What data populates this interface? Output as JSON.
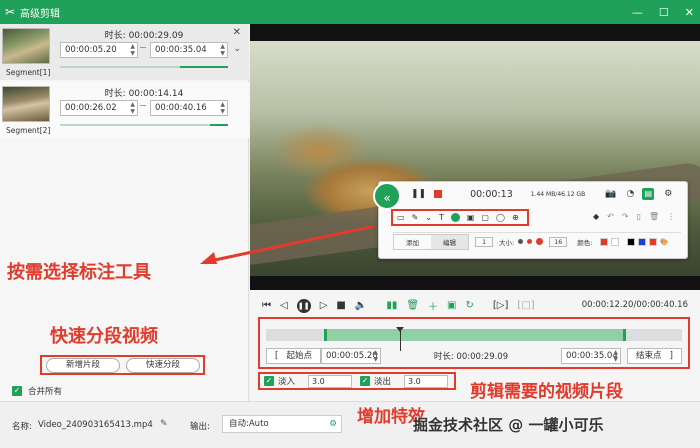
{
  "app": {
    "title": "高级剪辑",
    "window_controls": [
      "—",
      "☐",
      "✕"
    ]
  },
  "segments": [
    {
      "label": "Segment[1]",
      "duration": "时长: 00:00:29.09",
      "start": "00:00:05.20",
      "end": "00:00:35.04"
    },
    {
      "label": "Segment[2]",
      "duration": "时长: 00:00:14.14",
      "start": "00:00:26.02",
      "end": "00:00:40.16"
    }
  ],
  "segment_buttons": {
    "add": "新增片段",
    "quick_split": "快速分段"
  },
  "merge_all": "合并所有",
  "floating_toolbar": {
    "time": "00:00:13",
    "size": "1.44 MB/46.12 GB",
    "tab_add": "添加",
    "tab_edit": "编辑",
    "size_value": "1",
    "size_label": "大小:",
    "stroke_value": "16",
    "color_label": "颜色:"
  },
  "playback": {
    "time_display": "00:00:12.20/00:00:40.16"
  },
  "range": {
    "start_button": "起始点",
    "start_value": "00:00:05.20",
    "duration": "时长: 00:00:29.09",
    "end_value": "00:00:35.04",
    "end_button": "结束点",
    "left_bracket": "[",
    "right_bracket": "]"
  },
  "fade": {
    "fade_in_label": "淡入",
    "fade_in_value": "3.0",
    "fade_out_label": "淡出",
    "fade_out_value": "3.0"
  },
  "bottom": {
    "name_label": "名称:",
    "file_name": "Video_240903165413.mp4",
    "output_label": "输出:",
    "output_value": "自动:Auto"
  },
  "callouts": {
    "annotation_tools": "按需选择标注工具",
    "quick_split": "快速分段视频",
    "clip_needed": "剪辑需要的视频片段",
    "add_effects": "增加特效"
  },
  "watermark": "掘金技术社区 @ 一罐小可乐",
  "colors": {
    "accent": "#1fa15a",
    "callout": "#e03b2c"
  }
}
